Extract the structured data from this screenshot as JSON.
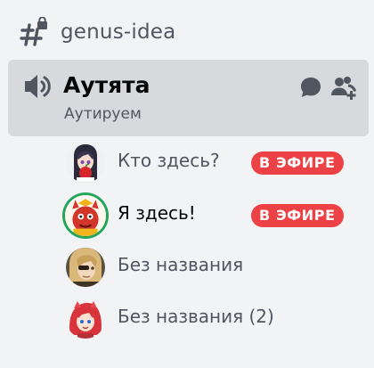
{
  "text_channel": {
    "name": "genus-idea",
    "icon": "hash-lock-icon"
  },
  "voice_channel": {
    "name": "Аутята",
    "status": "Аутируем",
    "icon": "speaker-icon",
    "actions": [
      "chat-icon",
      "invite-icon"
    ]
  },
  "participants": [
    {
      "name": "Кто здесь?",
      "live": true,
      "live_label": "В ЭФИРЕ",
      "speaking": false,
      "avatar": "anime-girl-red-apple-avatar"
    },
    {
      "name": "Я здесь!",
      "live": true,
      "live_label": "В ЭФИРЕ",
      "speaking": true,
      "avatar": "red-creature-avatar"
    },
    {
      "name": "Без названия",
      "live": false,
      "speaking": false,
      "avatar": "blonde-character-avatar"
    },
    {
      "name": "Без названия (2)",
      "live": false,
      "speaking": false,
      "avatar": "red-hair-character-avatar"
    }
  ],
  "colors": {
    "background": "#f2f3f5",
    "selected_background": "#d7d9dd",
    "live_badge": "#ed4245",
    "speaking_ring": "#23a55a",
    "muted_text": "#4f5660",
    "strong_text": "#060607"
  }
}
